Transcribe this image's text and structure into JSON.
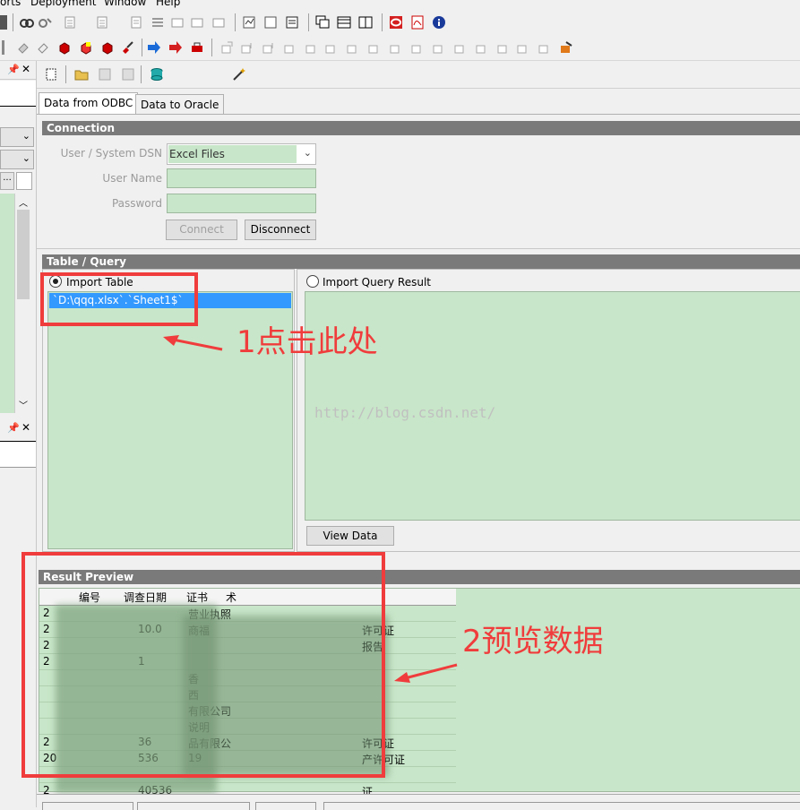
{
  "menu": {
    "items": [
      "orts",
      "Deployment",
      "Window",
      "Help"
    ]
  },
  "tabs": {
    "odbc": "Data from ODBC",
    "oracle": "Data to Oracle"
  },
  "connection": {
    "header": "Connection",
    "dsn_label": "User / System DSN",
    "dsn_value": "Excel Files",
    "username_label": "User Name",
    "password_label": "Password",
    "connect": "Connect",
    "disconnect": "Disconnect"
  },
  "table_query": {
    "header": "Table / Query",
    "import_table": "Import Table",
    "table_item": "`D:\\qqq.xlsx`.`Sheet1$`",
    "import_query": "Import Query Result",
    "view_data": "View Data"
  },
  "result": {
    "header": "Result Preview",
    "col_headers": [
      "编号",
      "调查日期",
      "证书",
      "术"
    ],
    "rows": [
      {
        "c1": "2",
        "c2": "",
        "c3": "营业执照"
      },
      {
        "c1": "2",
        "c2": "10.0",
        "c3": "商福",
        "c4": "许可证"
      },
      {
        "c1": "2",
        "c2": "",
        "c3": "",
        "c4": "报告"
      },
      {
        "c1": "2",
        "c2": "1",
        "c3": ""
      },
      {
        "c1": "",
        "c2": "",
        "c3": "香"
      },
      {
        "c1": "",
        "c2": "",
        "c3": "西"
      },
      {
        "c1": "",
        "c2": "",
        "c3": "有限公司"
      },
      {
        "c1": "",
        "c2": "",
        "c3": "说明"
      },
      {
        "c1": "2",
        "c2": "36",
        "c3": "品有限公",
        "c4": "许可证"
      },
      {
        "c1": "20",
        "c2": "536",
        "c3": "19",
        "c4": "产许可证"
      },
      {
        "c1": "",
        "c2": "",
        "c3": ""
      },
      {
        "c1": "2",
        "c2": "40536",
        "c3": "",
        "c4": "证"
      }
    ]
  },
  "annotations": {
    "step1": "1点击此处",
    "step2": "2预览数据"
  },
  "watermark": "http://blog.csdn.net/",
  "colors": {
    "green": "#c8e6c9",
    "header_gray": "#7a7a7a",
    "selection": "#3399ff",
    "annotation_red": "#f03c3c"
  }
}
